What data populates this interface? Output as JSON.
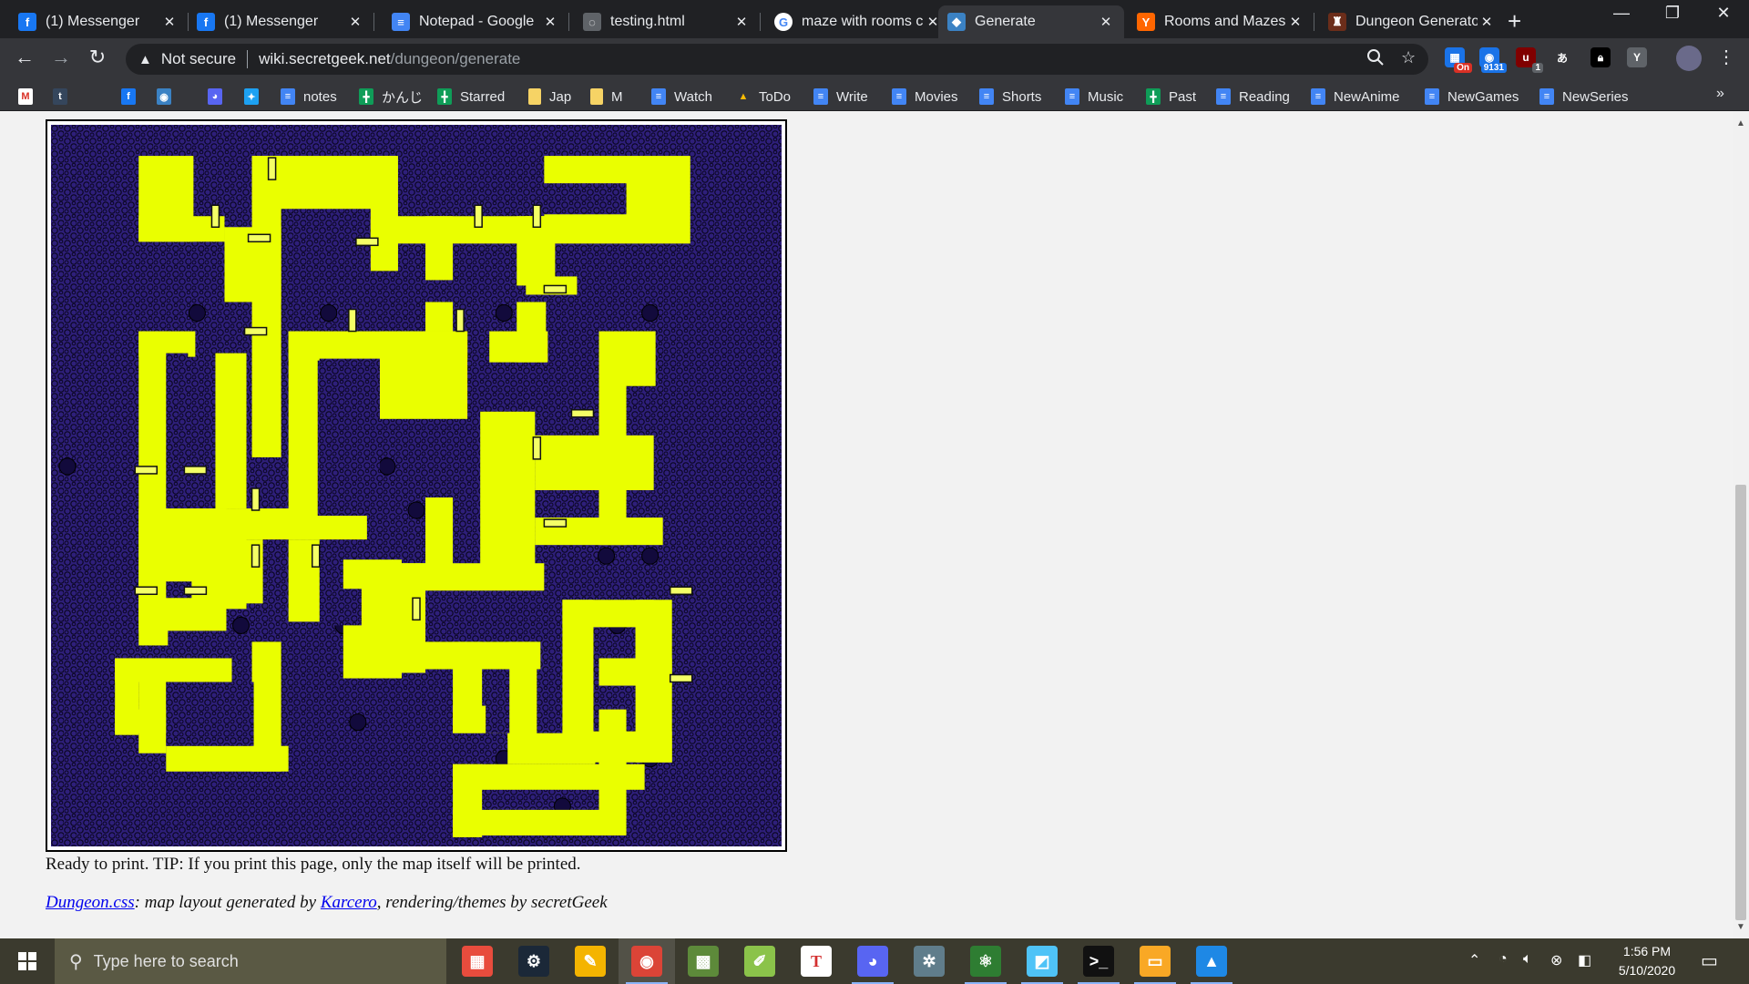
{
  "browser": {
    "tabs": [
      {
        "title": "(1) Messenger",
        "icon": "facebook-icon",
        "active": false
      },
      {
        "title": "(1) Messenger",
        "icon": "facebook-icon",
        "active": false
      },
      {
        "title": "Notepad - Google",
        "icon": "google-docs-icon",
        "active": false
      },
      {
        "title": "testing.html",
        "icon": "globe-icon",
        "active": false
      },
      {
        "title": "maze with rooms c",
        "icon": "google-icon",
        "active": false
      },
      {
        "title": "Generate",
        "icon": "generate-page-icon",
        "active": true
      },
      {
        "title": "Rooms and Mazes",
        "icon": "ycombinator-icon",
        "active": false
      },
      {
        "title": "Dungeon Generato",
        "icon": "dungeon-icon",
        "active": false
      }
    ],
    "tab_close_glyph": "✕",
    "new_tab_glyph": "+",
    "window_controls": {
      "minimize": "—",
      "restore": "❐",
      "close": "✕"
    },
    "address": {
      "security_label": "Not secure",
      "host": "wiki.secretgeek.net",
      "path": "/dungeon/generate"
    },
    "nav": {
      "back": "←",
      "forward": "→",
      "reload": "↻"
    },
    "extensions": [
      {
        "name": "calendar-extension-icon",
        "badge": "On",
        "badge_color": "#d93025"
      },
      {
        "name": "rss-extension-icon",
        "badge": "9131",
        "badge_color": "#1a73e8"
      },
      {
        "name": "ublock-extension-icon",
        "badge": "1",
        "badge_color": "#5f6368"
      },
      {
        "name": "translate-extension-icon",
        "badge": ""
      },
      {
        "name": "lock-extension-icon",
        "badge": ""
      },
      {
        "name": "y-extension-icon",
        "badge": ""
      }
    ],
    "bookmarks": [
      {
        "label": "",
        "icon": "gmail-icon"
      },
      {
        "label": "",
        "icon": "tumblr-icon"
      },
      {
        "label": "",
        "icon": "facebook-icon"
      },
      {
        "label": "",
        "icon": "feed-icon"
      },
      {
        "label": "",
        "icon": "discord-icon"
      },
      {
        "label": "",
        "icon": "twitter-icon"
      },
      {
        "label": "notes",
        "icon": "google-docs-icon"
      },
      {
        "label": "かんじ",
        "icon": "google-sheets-icon"
      },
      {
        "label": "Starred",
        "icon": "google-sheets-icon"
      },
      {
        "label": "Jap",
        "icon": "folder-icon"
      },
      {
        "label": "M",
        "icon": "folder-icon"
      },
      {
        "label": "Watch",
        "icon": "google-docs-icon"
      },
      {
        "label": "ToDo",
        "icon": "google-drive-icon"
      },
      {
        "label": "Write",
        "icon": "google-docs-icon"
      },
      {
        "label": "Movies",
        "icon": "google-docs-icon"
      },
      {
        "label": "Shorts",
        "icon": "google-docs-icon"
      },
      {
        "label": "Music",
        "icon": "google-docs-icon"
      },
      {
        "label": "Past",
        "icon": "google-sheets-icon"
      },
      {
        "label": "Reading",
        "icon": "google-docs-icon"
      },
      {
        "label": "NewAnime",
        "icon": "google-docs-icon"
      },
      {
        "label": "NewGames",
        "icon": "google-docs-icon"
      },
      {
        "label": "NewSeries",
        "icon": "google-docs-icon"
      }
    ],
    "bookmarks_overflow": "»"
  },
  "page": {
    "map": {
      "floor_color": "#eaff00",
      "rock_color": "#2e1f7a",
      "door_color": "#f4ff66"
    },
    "caption": "Ready to print. TIP: If you print this page, only the map itself will be printed.",
    "credits": {
      "link1": "Dungeon.css",
      "text1": ": map layout generated by ",
      "link2": "Karcero",
      "text2": ", rendering/themes by secretGeek"
    }
  },
  "taskbar": {
    "search_placeholder": "Type here to search",
    "apps": [
      "photos-collage-icon",
      "steam-icon",
      "pen-tool-icon",
      "chrome-icon",
      "minecraft-icon",
      "notepad-plus-icon",
      "typora-icon",
      "discord-icon",
      "settings-app-icon",
      "atom-icon",
      "note-app-icon",
      "terminal-icon",
      "file-explorer-icon",
      "photos-icon"
    ],
    "clock": {
      "time": "1:56 PM",
      "date": "5/10/2020"
    }
  }
}
